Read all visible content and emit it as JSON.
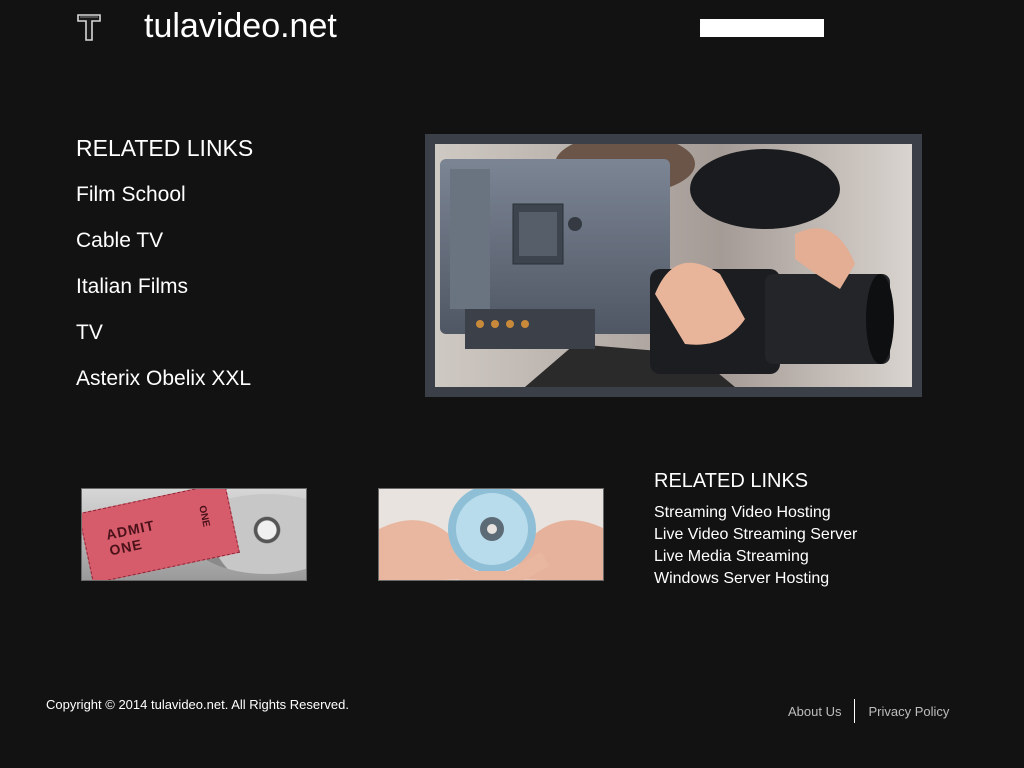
{
  "header": {
    "site_title": "tulavideo.net",
    "logo_icon": "t-logo-icon",
    "search": {
      "value": ""
    }
  },
  "main": {
    "related_links": {
      "heading": "RELATED LINKS",
      "items": [
        "Film School",
        "Cable TV",
        "Italian Films",
        "TV",
        "Asterix Obelix XXL"
      ]
    },
    "hero_image": {
      "icon": "video-camera-image"
    },
    "thumbnails": [
      {
        "icon": "admit-one-ticket-image",
        "ticket_text": "ADMIT ONE",
        "ticket_side": "ONE"
      },
      {
        "icon": "disc-in-hands-image"
      }
    ],
    "related_links_2": {
      "heading": "RELATED LINKS",
      "items": [
        "Streaming Video Hosting",
        "Live Video Streaming Server",
        "Live Media Streaming",
        "Windows Server Hosting"
      ]
    }
  },
  "footer": {
    "copyright": "Copyright © 2014 tulavideo.net. All Rights Reserved.",
    "links": [
      "About Us",
      "Privacy Policy"
    ]
  },
  "colors": {
    "background": "#121212",
    "hero_frame": "#3b4048",
    "text": "#ffffff",
    "footer_link": "#bdbdbd"
  }
}
